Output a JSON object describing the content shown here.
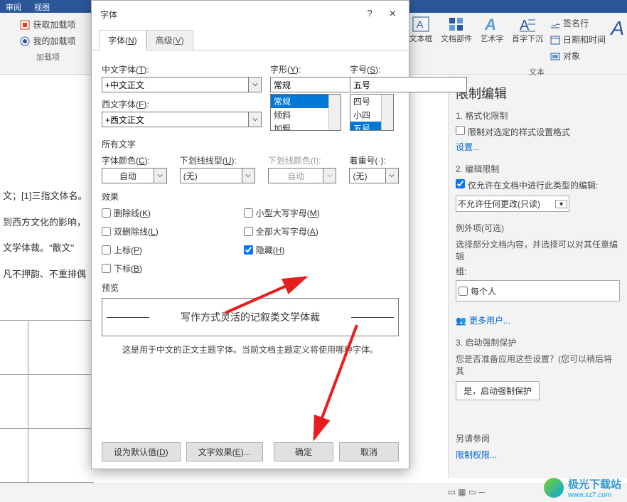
{
  "ribbon": {
    "tabs": [
      "审阅",
      "视图"
    ],
    "addin": {
      "get": "获取加载项",
      "my": "我的加载项",
      "group": "加载项"
    },
    "textgroup": {
      "textbox": "文本框",
      "parts": "文档部件",
      "wordart": "艺术字",
      "dropcap": "首字下沉",
      "sigline": "签名行",
      "datetime": "日期和时间",
      "object": "对象",
      "group": "文本"
    },
    "last_a": "A"
  },
  "doc": {
    "l1": "文；[1]三指文体名。",
    "l2": "到西方文化的影响，",
    "l3": "文学体裁。\"散文\"",
    "l4": "凡不押韵、不重排偶"
  },
  "dialog": {
    "title": "字体",
    "help": "?",
    "close": "×",
    "tab_font": "字体(N)",
    "tab_adv": "高级(V)",
    "cn_font_label": "中文字体(T):",
    "cn_font_val": "+中文正文",
    "west_font_label": "西文字体(F):",
    "west_font_val": "+西文正文",
    "style_label": "字形(Y):",
    "style_val": "常规",
    "style_list": [
      "常规",
      "倾斜",
      "加粗"
    ],
    "size_label": "字号(S):",
    "size_val": "五号",
    "size_list": [
      "四号",
      "小四",
      "五号"
    ],
    "allchar": "所有文字",
    "color_label": "字体颜色(C):",
    "color_val": "自动",
    "uline_label": "下划线线型(U):",
    "uline_val": "(无)",
    "ucolor_label": "下划线颜色(I):",
    "ucolor_val": "自动",
    "emph_label": "着重号(·):",
    "emph_val": "(无)",
    "effect": "效果",
    "strike": "删除线(K)",
    "dstrike": "双删除线(L)",
    "sup": "上标(P)",
    "sub": "下标(B)",
    "smallcaps": "小型大写字母(M)",
    "allcaps": "全部大写字母(A)",
    "hidden": "隐藏(H)",
    "preview": "预览",
    "preview_text": "写作方式灵活的记叙类文学体裁",
    "hint": "这是用于中文的正文主题字体。当前文档主题定义将使用哪种字体。",
    "default_btn": "设为默认值(D)",
    "texteffect_btn": "文字效果(E)...",
    "ok": "确定",
    "cancel": "取消"
  },
  "pane": {
    "title": "限制编辑",
    "s1": "1. 格式化限制",
    "s1_chk": "限制对选定的样式设置格式",
    "s1_link": "设置...",
    "s2": "2. 编辑限制",
    "s2_chk": "仅允许在文档中进行此类型的编辑:",
    "s2_sel": "不允许任何更改(只读)",
    "exc": "例外项(可选)",
    "exc_hint": "选择部分文档内容，并选择可以对其任意编辑",
    "exc_group": "组:",
    "exc_everyone": "每个人",
    "more": "更多用户...",
    "s3": "3. 启动强制保护",
    "s3_hint": "您是否准备应用这些设置？(您可以稍后将其",
    "s3_btn": "是，启动强制保护",
    "also": "另请参阅",
    "perm": "限制权限..."
  },
  "watermark": {
    "name": "极光下载站",
    "url": "www.xz7.com"
  }
}
